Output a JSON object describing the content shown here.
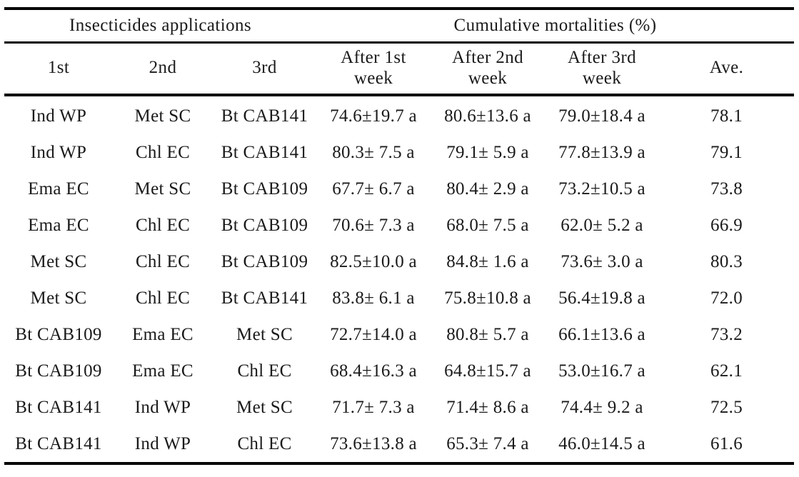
{
  "table": {
    "group_headers": [
      {
        "label": "Insecticides applications",
        "span": 3
      },
      {
        "label": "Cumulative mortalities (%)",
        "span": 4
      }
    ],
    "column_headers": [
      {
        "line1": "1st",
        "line2": ""
      },
      {
        "line1": "2nd",
        "line2": ""
      },
      {
        "line1": "3rd",
        "line2": ""
      },
      {
        "line1": "After 1st",
        "line2": "week"
      },
      {
        "line1": "After 2nd",
        "line2": "week"
      },
      {
        "line1": "After 3rd",
        "line2": "week"
      },
      {
        "line1": "Ave.",
        "line2": ""
      }
    ],
    "rows": [
      {
        "first": "Ind WP",
        "second": "Met SC",
        "third": "Bt CAB141",
        "week1": "74.6±19.7 a",
        "week2": "80.6±13.6 a",
        "week3": "79.0±18.4 a",
        "ave": "78.1"
      },
      {
        "first": "Ind WP",
        "second": "Chl EC",
        "third": "Bt CAB141",
        "week1": "80.3± 7.5 a",
        "week2": "79.1± 5.9 a",
        "week3": "77.8±13.9 a",
        "ave": "79.1"
      },
      {
        "first": "Ema EC",
        "second": "Met SC",
        "third": "Bt CAB109",
        "week1": "67.7± 6.7 a",
        "week2": "80.4± 2.9 a",
        "week3": "73.2±10.5 a",
        "ave": "73.8"
      },
      {
        "first": "Ema EC",
        "second": "Chl EC",
        "third": "Bt CAB109",
        "week1": "70.6± 7.3 a",
        "week2": "68.0± 7.5 a",
        "week3": "62.0± 5.2 a",
        "ave": "66.9"
      },
      {
        "first": "Met SC",
        "second": "Chl EC",
        "third": "Bt CAB109",
        "week1": "82.5±10.0 a",
        "week2": "84.8± 1.6 a",
        "week3": "73.6± 3.0 a",
        "ave": "80.3"
      },
      {
        "first": "Met SC",
        "second": "Chl EC",
        "third": "Bt CAB141",
        "week1": "83.8± 6.1 a",
        "week2": "75.8±10.8 a",
        "week3": "56.4±19.8 a",
        "ave": "72.0"
      },
      {
        "first": "Bt CAB109",
        "second": "Ema EC",
        "third": "Met SC",
        "week1": "72.7±14.0 a",
        "week2": "80.8± 5.7 a",
        "week3": "66.1±13.6 a",
        "ave": "73.2"
      },
      {
        "first": "Bt CAB109",
        "second": "Ema EC",
        "third": "Chl EC",
        "week1": "68.4±16.3 a",
        "week2": "64.8±15.7 a",
        "week3": "53.0±16.7 a",
        "ave": "62.1"
      },
      {
        "first": "Bt CAB141",
        "second": "Ind WP",
        "third": "Met SC",
        "week1": "71.7± 7.3 a",
        "week2": "71.4± 8.6 a",
        "week3": "74.4± 9.2 a",
        "ave": "72.5"
      },
      {
        "first": "Bt CAB141",
        "second": "Ind WP",
        "third": "Chl EC",
        "week1": "73.6±13.8 a",
        "week2": "65.3± 7.4 a",
        "week3": "46.0±14.5 a",
        "ave": "61.6"
      }
    ]
  },
  "colors": {
    "text": "#1a1a1a",
    "rule": "#000000",
    "background": "#ffffff"
  }
}
